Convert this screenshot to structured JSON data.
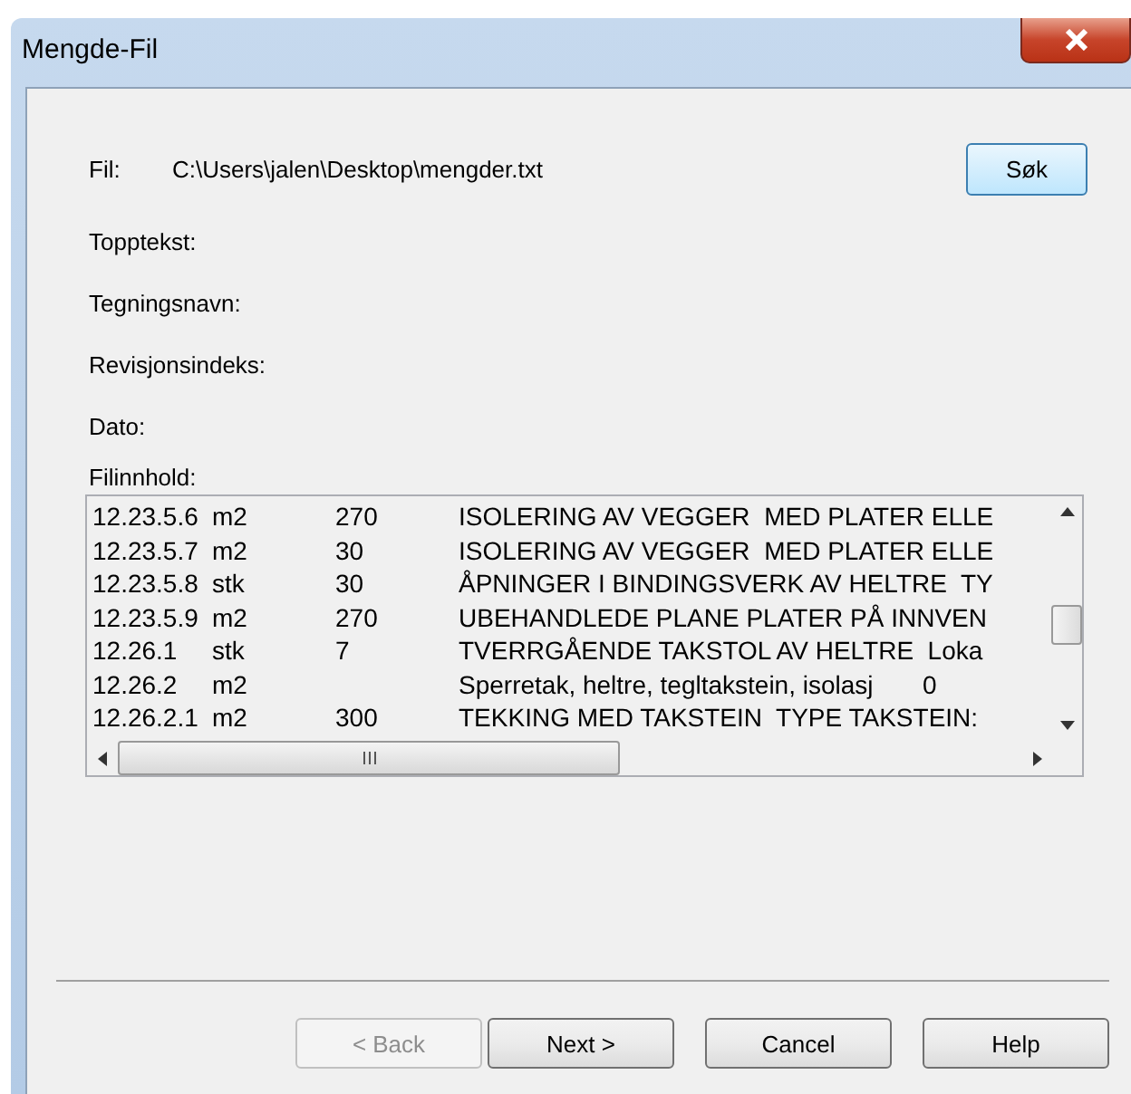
{
  "window": {
    "title": "Mengde-Fil"
  },
  "file": {
    "label": "Fil:",
    "value": "C:\\Users\\jalen\\Desktop\\mengder.txt",
    "button": "Søk"
  },
  "fields": [
    {
      "label": "Topptekst:"
    },
    {
      "label": "Tegningsnavn:"
    },
    {
      "label": "Revisjonsindeks:"
    },
    {
      "label": "Dato:"
    }
  ],
  "content": {
    "label": "Filinnhold:",
    "rows": [
      {
        "code": "12.23.5.6",
        "unit": "m2",
        "qty": "270",
        "text": "ISOLERING AV VEGGER  MED PLATER ELLE"
      },
      {
        "code": "12.23.5.7",
        "unit": "m2",
        "qty": "30",
        "text": "ISOLERING AV VEGGER  MED PLATER ELLE"
      },
      {
        "code": "12.23.5.8",
        "unit": "stk",
        "qty": "30",
        "text": "ÅPNINGER I BINDINGSVERK AV HELTRE  TY"
      },
      {
        "code": "12.23.5.9",
        "unit": "m2",
        "qty": "270",
        "text": "UBEHANDLEDE PLANE PLATER PÅ INNVEN"
      },
      {
        "code": "12.26.1",
        "unit": "stk",
        "qty": "7",
        "text": "TVERRGÅENDE TAKSTOL AV HELTRE  Loka"
      },
      {
        "code": "12.26.2",
        "unit": "m2",
        "qty": "",
        "text": "Sperretak, heltre, tegltakstein, isolasj       0"
      },
      {
        "code": "12.26.2.1",
        "unit": "m2",
        "qty": "300",
        "text": "TEKKING MED TAKSTEIN  TYPE TAKSTEIN:"
      }
    ]
  },
  "buttons": [
    {
      "label": "< Back",
      "disabled": true
    },
    {
      "label": "Next >",
      "disabled": false
    },
    {
      "label": "Cancel",
      "disabled": false
    },
    {
      "label": "Help",
      "disabled": false
    }
  ]
}
